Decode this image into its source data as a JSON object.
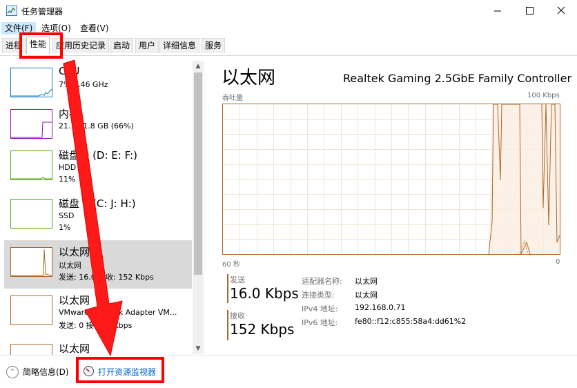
{
  "window": {
    "title": "任务管理器",
    "minimize_glyph": "—",
    "maximize_glyph": "☐",
    "close_glyph": "✕"
  },
  "menu": {
    "items": [
      "文件(F)",
      "选项(O)",
      "查看(V)"
    ]
  },
  "tabs": [
    "进程",
    "性能",
    "应用历史记录",
    "启动",
    "用户",
    "详细信息",
    "服务"
  ],
  "selected_tab": "性能",
  "sidebar": {
    "items": [
      {
        "title": "CPU",
        "sub1": "7%  1.46 GHz",
        "sub2": "",
        "color": "#117dbb"
      },
      {
        "title": "内存",
        "sub1": "21.1/31.8 GB (66%)",
        "sub2": "",
        "color": "#8b12ae"
      },
      {
        "title": "磁盘 0 (D: E: F:)",
        "sub1": "HDD",
        "sub2": "11%",
        "color": "#4da60c"
      },
      {
        "title": "磁盘 1 (C: J: H:)",
        "sub1": "SSD",
        "sub2": "1%",
        "color": "#4da60c"
      },
      {
        "title": "以太网",
        "sub1": "以太网",
        "sub2": "发送: 16.0 接收: 152 Kbps",
        "color": "#a9672b"
      },
      {
        "title": "以太网",
        "sub1": "VMware Network Adapter VM...",
        "sub2": "发送: 0 接收: 0 Kbps",
        "color": "#a9672b"
      },
      {
        "title": "以太网",
        "sub1": "",
        "sub2": "",
        "color": "#a9672b"
      }
    ],
    "selected_index": 4
  },
  "detail": {
    "title": "以太网",
    "adapter": "Realtek Gaming 2.5GbE Family Controller",
    "graph_label": "吞吐量",
    "graph_max": "100 Kbps",
    "axis_left": "60 秒",
    "axis_right": "0",
    "send_label": "发送",
    "send_value": "16.0 Kbps",
    "recv_label": "接收",
    "recv_value": "152 Kbps",
    "info": [
      {
        "key": "适配器名称:",
        "value": "以太网"
      },
      {
        "key": "连接类型:",
        "value": "以太网"
      },
      {
        "key": "IPv4 地址:",
        "value": "192.168.0.71"
      },
      {
        "key": "IPv6 地址:",
        "value": "fe80::f12:c855:58a4:dd61%2"
      }
    ],
    "graph_color": "#a9672b"
  },
  "footer": {
    "fewer_details": "简略信息(D)",
    "open_resmon": "打开资源监视器"
  },
  "scroll": {
    "up": "▲",
    "down": "▼"
  }
}
